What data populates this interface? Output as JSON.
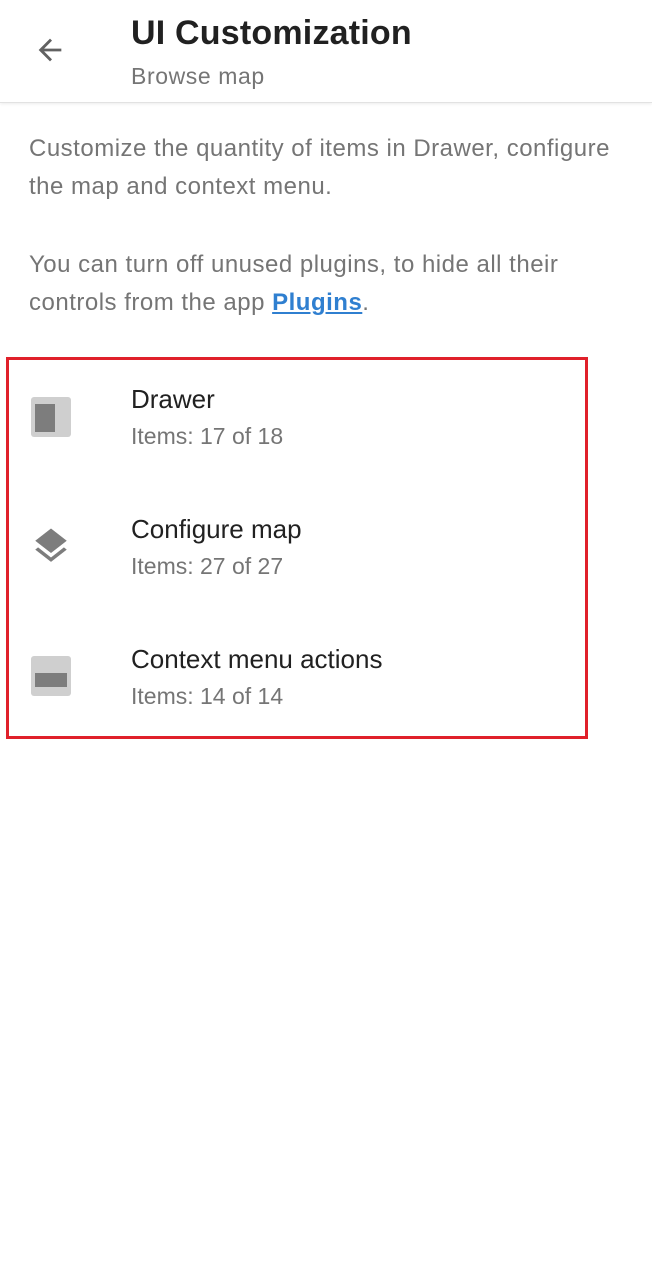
{
  "header": {
    "title": "UI Customization",
    "subtitle": "Browse map",
    "back_icon": "arrow-back-icon"
  },
  "description": {
    "paragraph1": "Customize the quantity of items in Drawer, configure the map and context menu.",
    "paragraph2_prefix": "You can turn off unused plugins, to hide all their controls from the app ",
    "plugins_link": "Plugins",
    "paragraph2_suffix": "."
  },
  "items": [
    {
      "icon": "drawer-icon",
      "title": "Drawer",
      "subtitle": "Items: 17 of 18"
    },
    {
      "icon": "layers-icon",
      "title": "Configure map",
      "subtitle": "Items: 27 of 27"
    },
    {
      "icon": "context-menu-icon",
      "title": "Context menu actions",
      "subtitle": "Items: 14 of 14"
    }
  ],
  "colors": {
    "highlight": "#e0202a",
    "link": "#2f7fd0",
    "icon_gray": "#8e8e8e"
  }
}
